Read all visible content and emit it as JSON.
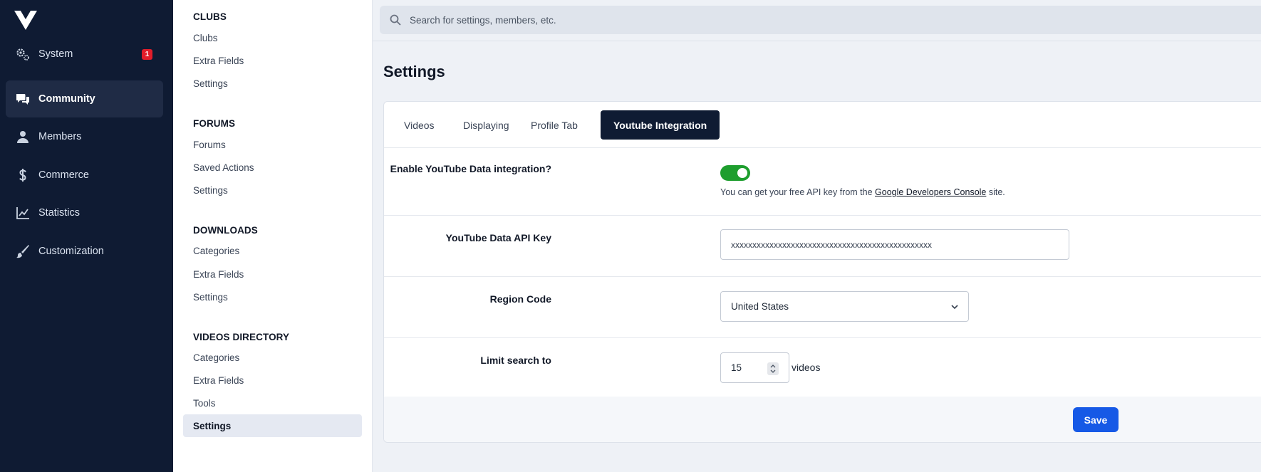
{
  "nav": {
    "items": [
      {
        "label": "System",
        "icon": "gears-icon",
        "badge": "1"
      },
      {
        "label": "Community",
        "icon": "chat-bubbles-icon"
      },
      {
        "label": "Members",
        "icon": "user-icon"
      },
      {
        "label": "Commerce",
        "icon": "dollar-icon"
      },
      {
        "label": "Statistics",
        "icon": "line-chart-icon"
      },
      {
        "label": "Customization",
        "icon": "brush-icon"
      }
    ],
    "active": "Community"
  },
  "subnav": {
    "sections": [
      {
        "title": "CLUBS",
        "items": [
          "Clubs",
          "Extra Fields",
          "Settings"
        ]
      },
      {
        "title": "FORUMS",
        "items": [
          "Forums",
          "Saved Actions",
          "Settings"
        ]
      },
      {
        "title": "DOWNLOADS",
        "items": [
          "Categories",
          "Extra Fields",
          "Settings"
        ]
      },
      {
        "title": "VIDEOS DIRECTORY",
        "items": [
          "Categories",
          "Extra Fields",
          "Tools",
          "Settings"
        ]
      }
    ],
    "active": "VIDEOS DIRECTORY / Settings"
  },
  "search": {
    "placeholder": "Search for settings, members, etc."
  },
  "page": {
    "title": "Settings"
  },
  "tabs": [
    "Videos",
    "Displaying",
    "Profile Tab",
    "Youtube Integration"
  ],
  "active_tab": "Youtube Integration",
  "form": {
    "youtube_enable": {
      "label": "Enable YouTube Data integration?",
      "enabled": true,
      "hint_before": "You can get your free API key from the ",
      "hint_link": "Google Developers Console",
      "hint_after": " site."
    },
    "api_key": {
      "label": "YouTube Data API Key",
      "value": "xxxxxxxxxxxxxxxxxxxxxxxxxxxxxxxxxxxxxxxxxxxxxxx"
    },
    "region": {
      "label": "Region Code",
      "value": "United States"
    },
    "limit": {
      "label": "Limit search to",
      "value": "15",
      "unit": "videos"
    }
  },
  "footer": {
    "save_label": "Save"
  },
  "colors": {
    "nav_bg": "#0f1b33",
    "toggle_on": "#1e9e2e",
    "primary_button": "#1659e6",
    "badge": "#e11d2a"
  }
}
